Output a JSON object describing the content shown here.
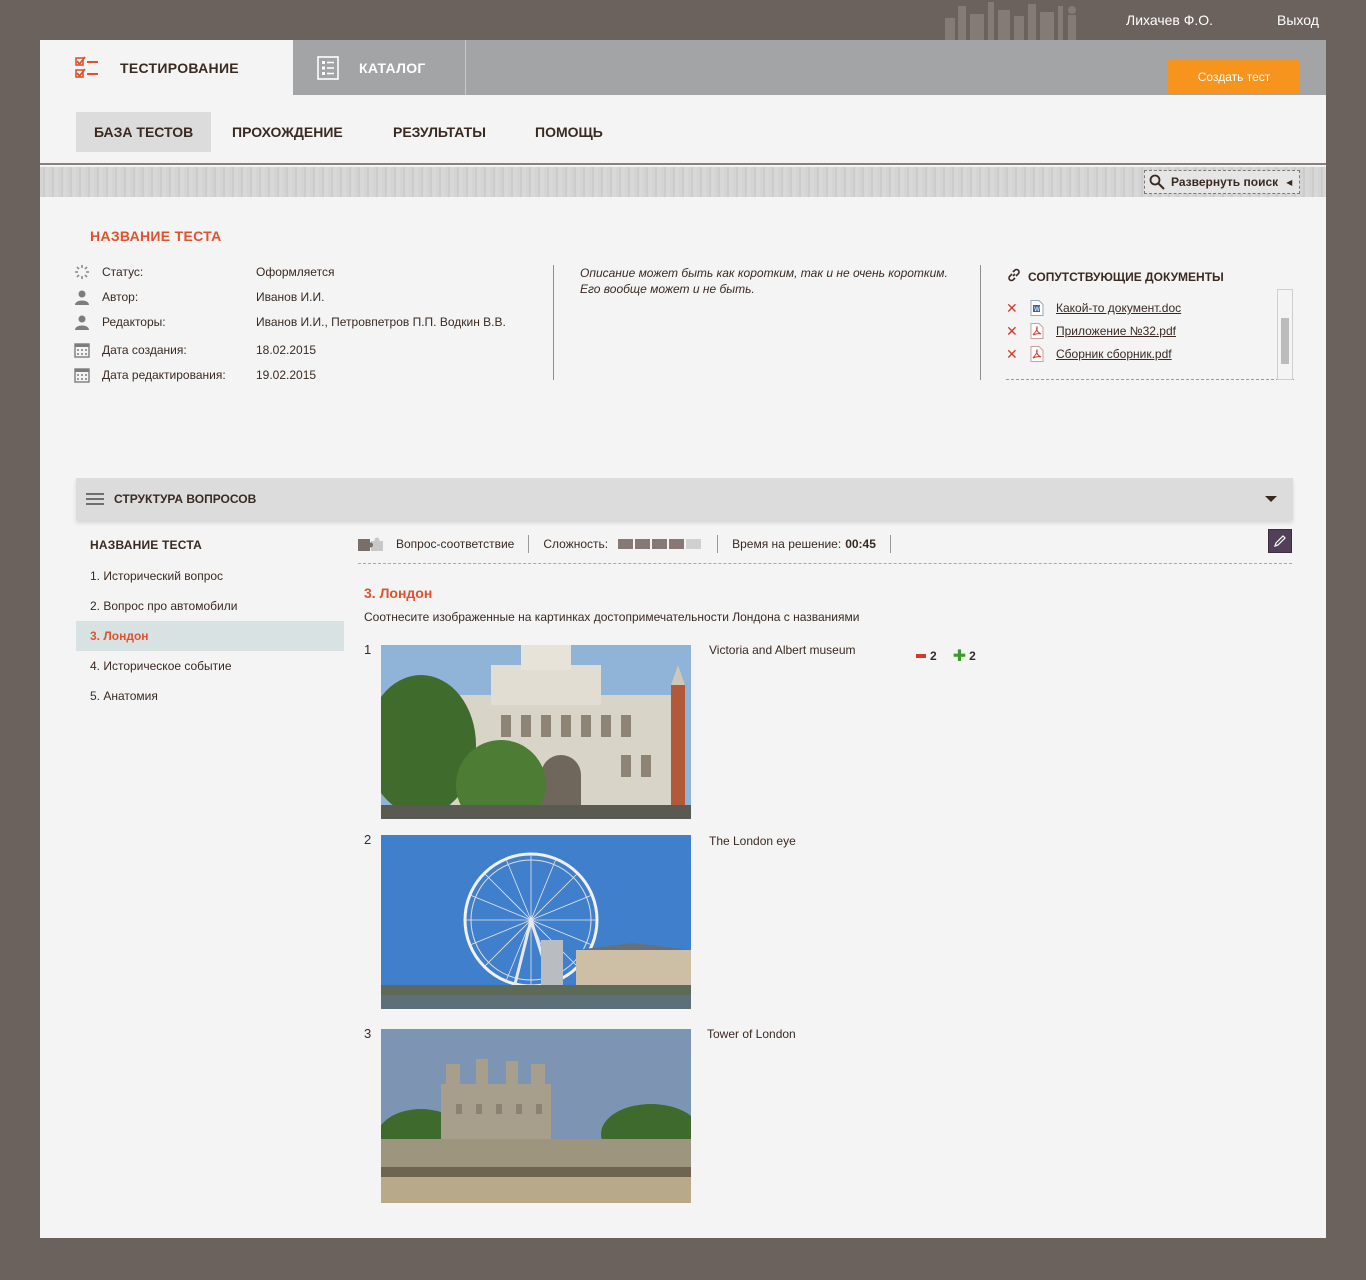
{
  "topbar": {
    "user_name": "Лихачев Ф.О.",
    "logout_label": "Выход"
  },
  "header": {
    "tabs": [
      {
        "label": "ТЕСТИРОВАНИЕ",
        "icon": "checklist-icon",
        "active": true
      },
      {
        "label": "КАТАЛОГ",
        "icon": "catalog-list-icon",
        "active": false
      }
    ],
    "create_button": "Создать тест"
  },
  "subnav": {
    "items": [
      {
        "label": "БАЗА ТЕСТОВ",
        "active": true
      },
      {
        "label": "ПРОХОЖДЕНИЕ",
        "active": false
      },
      {
        "label": "РЕЗУЛЬТАТЫ",
        "active": false
      },
      {
        "label": "ПОМОЩЬ",
        "active": false
      }
    ]
  },
  "search": {
    "expand_label": "Развернуть поиск"
  },
  "test": {
    "title": "НАЗВАНИЕ ТЕСТА",
    "fields": [
      {
        "label": "Статус:",
        "value": "Оформляется",
        "icon": "status-spinner-icon"
      },
      {
        "label": "Автор:",
        "value": "Иванов И.И.",
        "icon": "user-icon"
      },
      {
        "label": "Редакторы:",
        "value": "Иванов И.И., Петровпетров П.П. Водкин В.В.",
        "icon": "user-icon"
      },
      {
        "label": "Дата создания:",
        "value": "18.02.2015",
        "icon": "calendar-icon"
      },
      {
        "label": "Дата редактирования:",
        "value": "19.02.2015",
        "icon": "calendar-icon"
      }
    ],
    "description": "Описание может быть как коротким, так и не очень коротким. Его вообще может и не быть."
  },
  "documents": {
    "title": "СОПУТСТВУЮЩИЕ ДОКУМЕНТЫ",
    "items": [
      {
        "name": "Какой-то документ.doc",
        "type": "doc"
      },
      {
        "name": "Приложение №32.pdf",
        "type": "pdf"
      },
      {
        "name": "Сборник сборник.pdf",
        "type": "pdf"
      }
    ]
  },
  "structure": {
    "title": "СТРУКТУРА ВОПРОСОВ",
    "list_title": "НАЗВАНИЕ ТЕСТА",
    "questions": [
      {
        "label": "1. Исторический вопрос",
        "active": false
      },
      {
        "label": "2. Вопрос про автомобили",
        "active": false
      },
      {
        "label": "3. Лондон",
        "active": true
      },
      {
        "label": "4. Историческое событие",
        "active": false
      },
      {
        "label": "5. Анатомия",
        "active": false
      }
    ]
  },
  "question": {
    "type_label": "Вопрос-соответствие",
    "difficulty_label": "Сложность:",
    "difficulty": {
      "value": 4,
      "max": 5
    },
    "time_label": "Время на решение:",
    "time_value": "00:45",
    "title": "3. Лондон",
    "text": "Соотнесите изображенные на картинках достопримечательности Лондона с названиями",
    "pairs": [
      {
        "number": "1",
        "name": "Victoria and Albert museum"
      },
      {
        "number": "2",
        "name": "The London eye"
      },
      {
        "number": "3",
        "name": "Tower of London"
      }
    ],
    "score": {
      "minus": "2",
      "plus": "2"
    }
  },
  "colors": {
    "accent": "#e0522e",
    "button": "#f7941d",
    "background": "#6b615d"
  }
}
